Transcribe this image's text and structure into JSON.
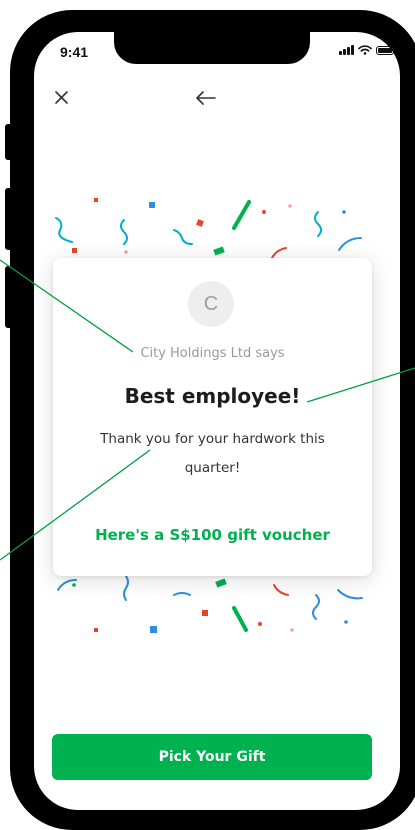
{
  "status_bar": {
    "time": "9:41"
  },
  "nav": {
    "close_icon": "close-icon",
    "back_icon": "arrow-left-icon"
  },
  "card": {
    "avatar_initial": "C",
    "sender": "City Holdings Ltd says",
    "headline": "Best employee!",
    "message": "Thank you for your hardwork this quarter!",
    "voucher": "Here's a S$100 gift voucher"
  },
  "cta": {
    "label": "Pick Your Gift"
  },
  "colors": {
    "brand_green": "#00b14f",
    "confetti": [
      "#00b14f",
      "#e8442a",
      "#2e8fe0",
      "#f2a3a3"
    ]
  }
}
